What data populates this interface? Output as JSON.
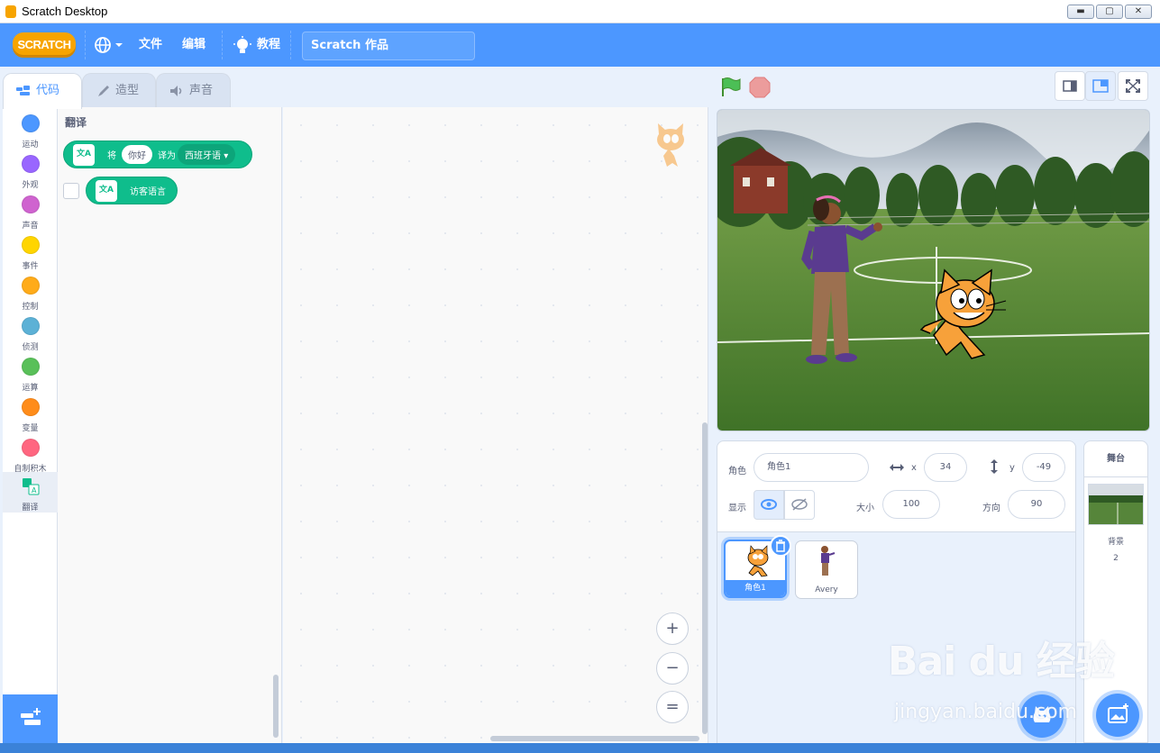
{
  "window": {
    "title": "Scratch Desktop",
    "minimize": "▬",
    "maximize": "▢",
    "close": "✕"
  },
  "menu": {
    "logo": "SCRATCH",
    "file": "文件",
    "edit": "编辑",
    "tutorials": "教程",
    "project_title": "Scratch 作品"
  },
  "tabs": [
    {
      "label": "代码"
    },
    {
      "label": "造型"
    },
    {
      "label": "声音"
    }
  ],
  "categories": [
    {
      "label": "运动",
      "color": "#4c97ff"
    },
    {
      "label": "外观",
      "color": "#9966ff"
    },
    {
      "label": "声音",
      "color": "#cf63cf"
    },
    {
      "label": "事件",
      "color": "#ffd500"
    },
    {
      "label": "控制",
      "color": "#ffab19"
    },
    {
      "label": "侦测",
      "color": "#5cb1d6"
    },
    {
      "label": "运算",
      "color": "#59c059"
    },
    {
      "label": "变量",
      "color": "#ff8c1a"
    },
    {
      "label": "自制积木",
      "color": "#ff6680"
    },
    {
      "label": "翻译",
      "color": "#0fbd8c"
    }
  ],
  "palette": {
    "heading": "翻译",
    "translate_block": {
      "prefix": "将",
      "text": "你好",
      "middle": "译为",
      "language": "西班牙语"
    },
    "visitor_block": {
      "label": "访客语言"
    },
    "icon_text": "文A"
  },
  "zoom": {
    "in": "+",
    "out": "−",
    "reset": "="
  },
  "sprite_info": {
    "sprite_label": "角色",
    "sprite_name": "角色1",
    "x_label": "x",
    "x_value": "34",
    "y_label": "y",
    "y_value": "-49",
    "show_label": "显示",
    "size_label": "大小",
    "size_value": "100",
    "direction_label": "方向",
    "direction_value": "90"
  },
  "sprites": [
    {
      "name": "角色1",
      "selected": true
    },
    {
      "name": "Avery",
      "selected": false
    }
  ],
  "stage_pane": {
    "title": "舞台",
    "backdrops_label": "背景",
    "backdrops_count": "2"
  },
  "watermark": {
    "main": "Bai du 经验",
    "sub": "jingyan.baidu.com"
  }
}
